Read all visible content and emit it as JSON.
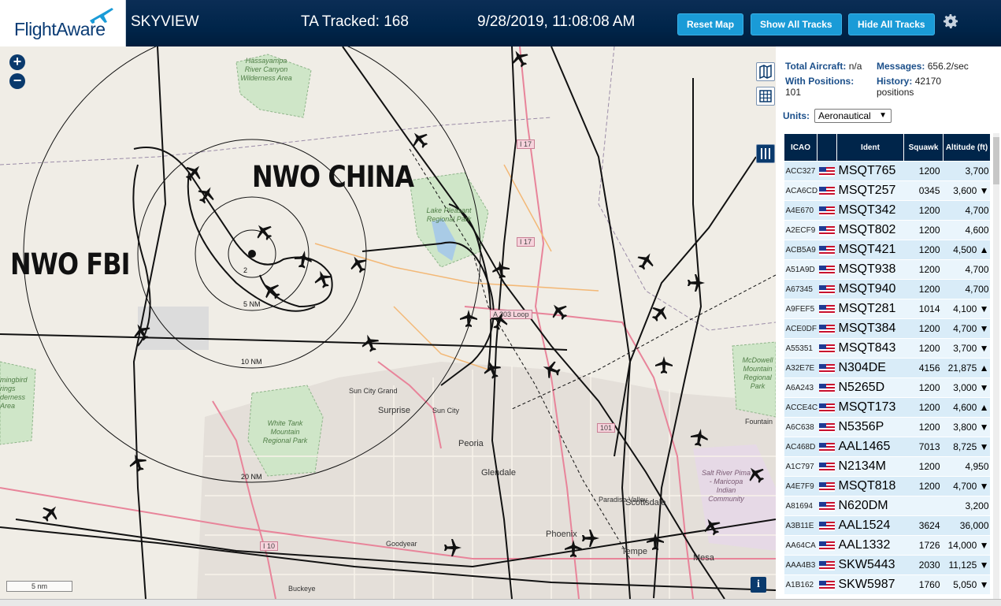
{
  "header": {
    "logo_text": "FlightAware",
    "site": "SKYVIEW",
    "tracked": "TA Tracked: 168",
    "datetime": "9/28/2019, 11:08:08 AM",
    "reset_btn": "Reset Map",
    "show_btn": "Show All Tracks",
    "hide_btn": "Hide All Tracks",
    "settings_icon": "gear-icon"
  },
  "map": {
    "annotations": {
      "china": "NWO CHINA",
      "fbi": "NWO FBI"
    },
    "range_rings": [
      "2",
      "5 NM",
      "10 NM",
      "20 NM"
    ],
    "places": [
      "Hassayampa River Canyon Wilderness Area",
      "Lake Pleasant Regional Park",
      "White Tank Mountain Regional Park",
      "McDowell Mountain Regional Park",
      "Salt River Pima - Maricopa Indian Community",
      "Sun City Grand",
      "Surprise",
      "Sun City",
      "Peoria",
      "Glendale",
      "Paradise Valley",
      "Scottsdale",
      "Phoenix",
      "Tempe",
      "Mesa",
      "Goodyear",
      "Buckeye",
      "Fountain",
      "mingbird rings derness Area"
    ],
    "roads": [
      "I 17",
      "I 17",
      "A 303 Loop",
      "101",
      "I 10"
    ],
    "scale": "5 nm",
    "zoom_in": "+",
    "zoom_out": "−",
    "info": "i"
  },
  "stats": {
    "total_label": "Total Aircraft:",
    "total_value": "n/a",
    "messages_label": "Messages:",
    "messages_value": "656.2/sec",
    "positions_label": "With Positions:",
    "positions_value": "101",
    "history_label": "History:",
    "history_value": "42170 positions",
    "units_label": "Units:",
    "units_value": "Aeronautical"
  },
  "table": {
    "headers": [
      "ICAO",
      "",
      "Ident",
      "Squawk",
      "Altitude (ft)"
    ],
    "rows": [
      {
        "icao": "ACC327",
        "ident": "MSQT765",
        "squawk": "1200",
        "alt": "3,700"
      },
      {
        "icao": "ACA6CD",
        "ident": "MSQT257",
        "squawk": "0345",
        "alt": "3,600 ▼"
      },
      {
        "icao": "A4E670",
        "ident": "MSQT342",
        "squawk": "1200",
        "alt": "4,700"
      },
      {
        "icao": "A2ECF9",
        "ident": "MSQT802",
        "squawk": "1200",
        "alt": "4,600"
      },
      {
        "icao": "ACB5A9",
        "ident": "MSQT421",
        "squawk": "1200",
        "alt": "4,500 ▲"
      },
      {
        "icao": "A51A9D",
        "ident": "MSQT938",
        "squawk": "1200",
        "alt": "4,700"
      },
      {
        "icao": "A67345",
        "ident": "MSQT940",
        "squawk": "1200",
        "alt": "4,700"
      },
      {
        "icao": "A9FEF5",
        "ident": "MSQT281",
        "squawk": "1014",
        "alt": "4,100 ▼"
      },
      {
        "icao": "ACE0DF",
        "ident": "MSQT384",
        "squawk": "1200",
        "alt": "4,700 ▼"
      },
      {
        "icao": "A55351",
        "ident": "MSQT843",
        "squawk": "1200",
        "alt": "3,700 ▼"
      },
      {
        "icao": "A32E7E",
        "ident": "N304DE",
        "squawk": "4156",
        "alt": "21,875 ▲"
      },
      {
        "icao": "A6A243",
        "ident": "N5265D",
        "squawk": "1200",
        "alt": "3,000 ▼"
      },
      {
        "icao": "ACCE4C",
        "ident": "MSQT173",
        "squawk": "1200",
        "alt": "4,600 ▲"
      },
      {
        "icao": "A6C638",
        "ident": "N5356P",
        "squawk": "1200",
        "alt": "3,800 ▼"
      },
      {
        "icao": "AC468D",
        "ident": "AAL1465",
        "squawk": "7013",
        "alt": "8,725 ▼"
      },
      {
        "icao": "A1C797",
        "ident": "N2134M",
        "squawk": "1200",
        "alt": "4,950"
      },
      {
        "icao": "A4E7F9",
        "ident": "MSQT818",
        "squawk": "1200",
        "alt": "4,700 ▼"
      },
      {
        "icao": "A81694",
        "ident": "N620DM",
        "squawk": "",
        "alt": "3,200"
      },
      {
        "icao": "A3B11E",
        "ident": "AAL1524",
        "squawk": "3624",
        "alt": "36,000"
      },
      {
        "icao": "AA64CA",
        "ident": "AAL1332",
        "squawk": "1726",
        "alt": "14,000 ▼"
      },
      {
        "icao": "AAA4B3",
        "ident": "SKW5443",
        "squawk": "2030",
        "alt": "11,125 ▼"
      },
      {
        "icao": "A1B162",
        "ident": "SKW5987",
        "squawk": "1760",
        "alt": "5,050 ▼"
      }
    ]
  }
}
